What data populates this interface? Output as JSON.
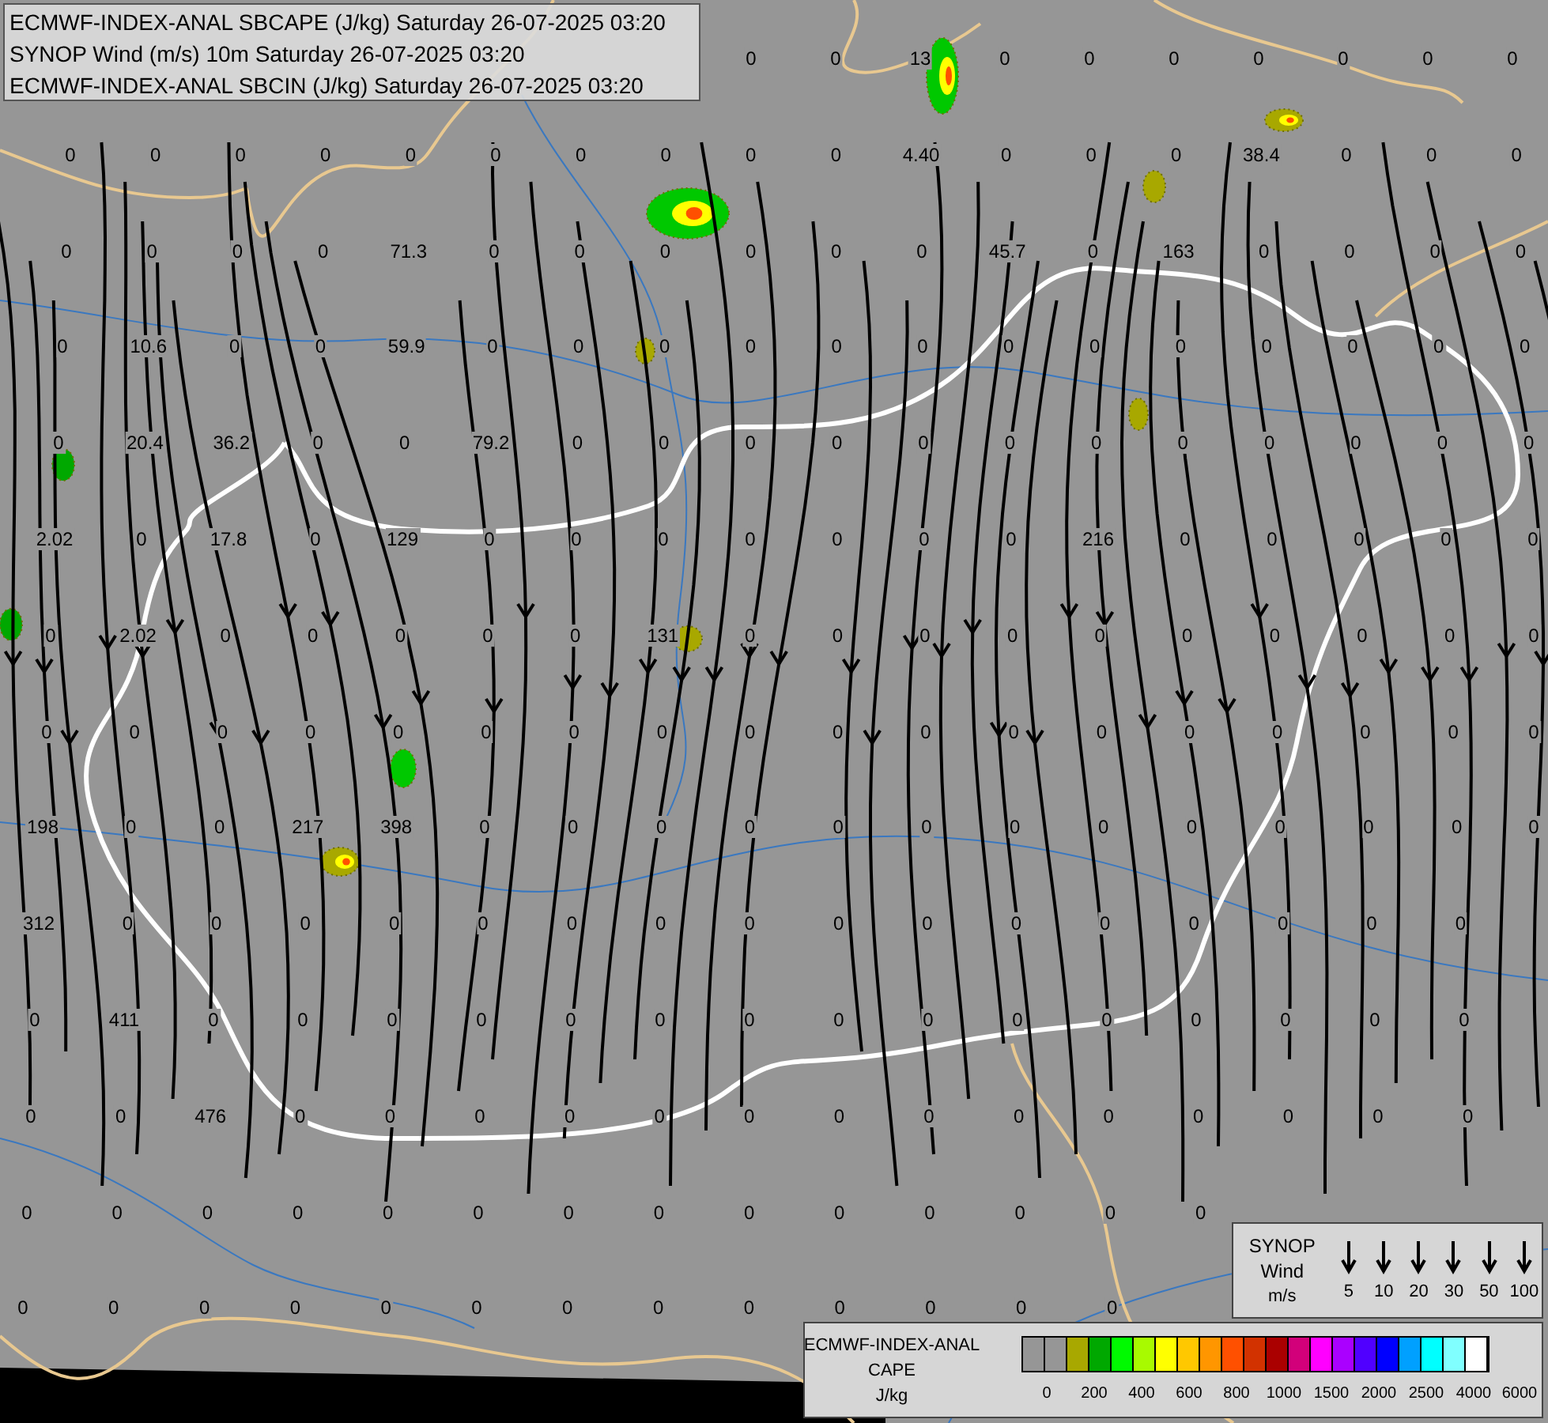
{
  "header": {
    "lines": [
      "ECMWF-INDEX-ANAL SBCAPE (J/kg) Saturday 26-07-2025 03:20",
      "SYNOP Wind (m/s) 10m Saturday 26-07-2025 03:20",
      "ECMWF-INDEX-ANAL SBCIN (J/kg) Saturday 26-07-2025 03:20"
    ]
  },
  "map": {
    "value_rows": [
      [
        null,
        null,
        null,
        null,
        null,
        null,
        null,
        null,
        "0",
        "0",
        "13",
        "0",
        "0",
        "0",
        "0",
        "0",
        "0",
        "0"
      ],
      [
        "0",
        "0",
        "0",
        "0",
        "0",
        "0",
        "0",
        "0",
        "0",
        "0",
        "4.40",
        "0",
        "0",
        "0",
        "38.4",
        "0",
        "0",
        "0"
      ],
      [
        "0",
        "0",
        "0",
        "0",
        "71.3",
        "0",
        "0",
        "0",
        "0",
        "0",
        "0",
        "45.7",
        "0",
        "163",
        "0",
        "0",
        "0",
        "0"
      ],
      [
        "0",
        "10.6",
        "0",
        "0",
        "59.9",
        "0",
        "0",
        "0",
        "0",
        "0",
        "0",
        "0",
        "0",
        "0",
        "0",
        "0",
        "0",
        "0"
      ],
      [
        "0",
        "20.4",
        "36.2",
        "0",
        "0",
        "79.2",
        "0",
        "0",
        "0",
        "0",
        "0",
        "0",
        "0",
        "0",
        "0",
        "0",
        "0",
        "0"
      ],
      [
        "2.02",
        "0",
        "17.8",
        "0",
        "129",
        "0",
        "0",
        "0",
        "0",
        "0",
        "0",
        "0",
        "216",
        "0",
        "0",
        "0",
        "0",
        "0"
      ],
      [
        "0",
        "2.02",
        "0",
        "0",
        "0",
        "0",
        "0",
        "131",
        "0",
        "0",
        "0",
        "0",
        "0",
        "0",
        "0",
        "0",
        "0",
        "0"
      ],
      [
        "0",
        "0",
        "0",
        "0",
        "0",
        "0",
        "0",
        "0",
        "0",
        "0",
        "0",
        "0",
        "0",
        "0",
        "0",
        "0",
        "0",
        "0"
      ],
      [
        "198",
        "0",
        "0",
        "217",
        "398",
        "0",
        "0",
        "0",
        "0",
        "0",
        "0",
        "0",
        "0",
        "0",
        "0",
        "0",
        "0",
        "0"
      ],
      [
        "312",
        "0",
        "0",
        "0",
        "0",
        "0",
        "0",
        "0",
        "0",
        "0",
        "0",
        "0",
        "0",
        "0",
        "0",
        "0",
        "0"
      ],
      [
        "0",
        "411",
        "0",
        "0",
        "0",
        "0",
        "0",
        "0",
        "0",
        "0",
        "0",
        "0",
        "0",
        "0",
        "0",
        "0",
        "0"
      ],
      [
        "0",
        "0",
        "476",
        "0",
        "0",
        "0",
        "0",
        "0",
        "0",
        "0",
        "0",
        "0",
        "0",
        "0",
        "0",
        "0",
        "0"
      ],
      [
        "0",
        "0",
        "0",
        "0",
        "0",
        "0",
        "0",
        "0",
        "0",
        "0",
        "0",
        "0",
        "0",
        "0"
      ],
      [
        "0",
        "0",
        "0",
        "0",
        "0",
        "0",
        "0",
        "0",
        "0",
        "0",
        "0",
        "0",
        "0"
      ]
    ]
  },
  "wind_legend": {
    "lines": [
      "SYNOP",
      "Wind",
      "m/s"
    ],
    "speeds": [
      "5",
      "10",
      "20",
      "30",
      "50",
      "100"
    ]
  },
  "cape_legend": {
    "lines": [
      "ECMWF-INDEX-ANAL",
      "CAPE",
      "J/kg"
    ],
    "swatches": [
      {
        "color": "#969696"
      },
      {
        "color": "#969696"
      },
      {
        "color": "#a8a800"
      },
      {
        "color": "#00a800"
      },
      {
        "color": "#00fa00"
      },
      {
        "color": "#a8fa00"
      },
      {
        "color": "#ffff00"
      },
      {
        "color": "#ffc800"
      },
      {
        "color": "#ff9600"
      },
      {
        "color": "#ff5000"
      },
      {
        "color": "#d23200"
      },
      {
        "color": "#aa0000"
      },
      {
        "color": "#d2007a"
      },
      {
        "color": "#ff00ff"
      },
      {
        "color": "#aa00ff"
      },
      {
        "color": "#5000ff"
      },
      {
        "color": "#0000ff"
      },
      {
        "color": "#00a0ff"
      },
      {
        "color": "#00ffff"
      },
      {
        "color": "#80ffff"
      },
      {
        "color": "#ffffff"
      }
    ],
    "ticks": [
      "0",
      "200",
      "400",
      "600",
      "800",
      "1000",
      "1500",
      "2000",
      "2500",
      "4000",
      "6000"
    ]
  }
}
